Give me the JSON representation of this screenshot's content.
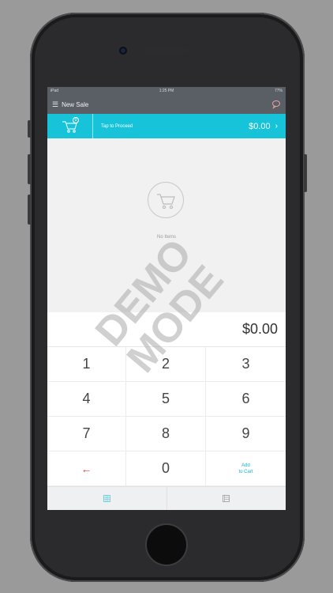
{
  "status_bar": {
    "carrier": "iPad",
    "time": "1:25 PM",
    "battery": "77%"
  },
  "nav": {
    "title": "New Sale",
    "menu_icon": "hamburger-menu-icon",
    "chat_icon": "chat-bubble-icon"
  },
  "cart_bar": {
    "badge": "0",
    "proceed_label": "Tap to Proceed",
    "total": "$0.00",
    "chevron": "›"
  },
  "items": {
    "empty_label": "No Items"
  },
  "amount": "$0.00",
  "keypad": {
    "k1": "1",
    "k2": "2",
    "k3": "3",
    "k4": "4",
    "k5": "5",
    "k6": "6",
    "k7": "7",
    "k8": "8",
    "k9": "9",
    "back": "←",
    "k0": "0",
    "add_line1": "Add",
    "add_line2": "to Cart"
  },
  "watermark": {
    "line1": "DEMO",
    "line2": "MODE"
  },
  "colors": {
    "accent": "#17c3d8",
    "navbar": "#5a5f66",
    "backspace": "#e0453a"
  }
}
